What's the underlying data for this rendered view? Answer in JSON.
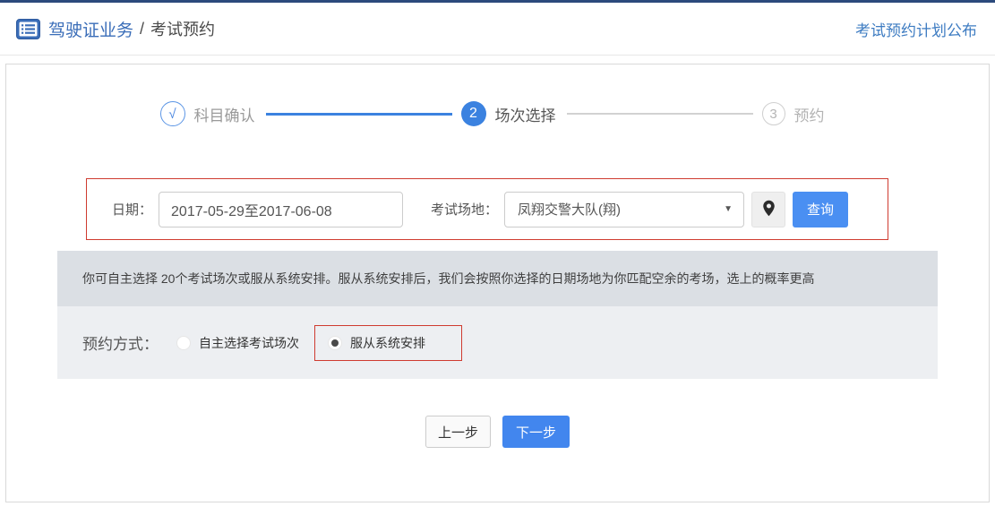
{
  "header": {
    "breadcrumb_primary": "驾驶证业务",
    "breadcrumb_separator": "/",
    "breadcrumb_current": "考试预约",
    "plan_link": "考试预约计划公布"
  },
  "stepper": {
    "steps": [
      {
        "indicator": "√",
        "label": "科目确认",
        "state": "done"
      },
      {
        "indicator": "2",
        "label": "场次选择",
        "state": "active"
      },
      {
        "indicator": "3",
        "label": "预约",
        "state": "pending"
      }
    ]
  },
  "filter": {
    "date_label": "日期：",
    "date_value": "2017-05-29至2017-06-08",
    "venue_label": "考试场地：",
    "venue_selected": "凤翔交警大队(翔)",
    "caret": "▼",
    "search_label": "查询"
  },
  "notice_text": "你可自主选择 20个考试场次或服从系统安排。服从系统安排后，我们会按照你选择的日期场地为你匹配空余的考场，选上的概率更高",
  "method": {
    "label": "预约方式：",
    "options": [
      {
        "label": "自主选择考试场次",
        "selected": false
      },
      {
        "label": "服从系统安排",
        "selected": true
      }
    ]
  },
  "actions": {
    "prev_label": "上一步",
    "next_label": "下一步"
  },
  "colors": {
    "top_bar": "#2c4a7c",
    "accent_blue": "#3b82e0",
    "button_blue": "#4a8ff2",
    "link_blue": "#3e7cc2",
    "highlight_red": "#cf3b30",
    "notice_bg": "#dbdfe4",
    "method_bg": "#edeff2"
  }
}
